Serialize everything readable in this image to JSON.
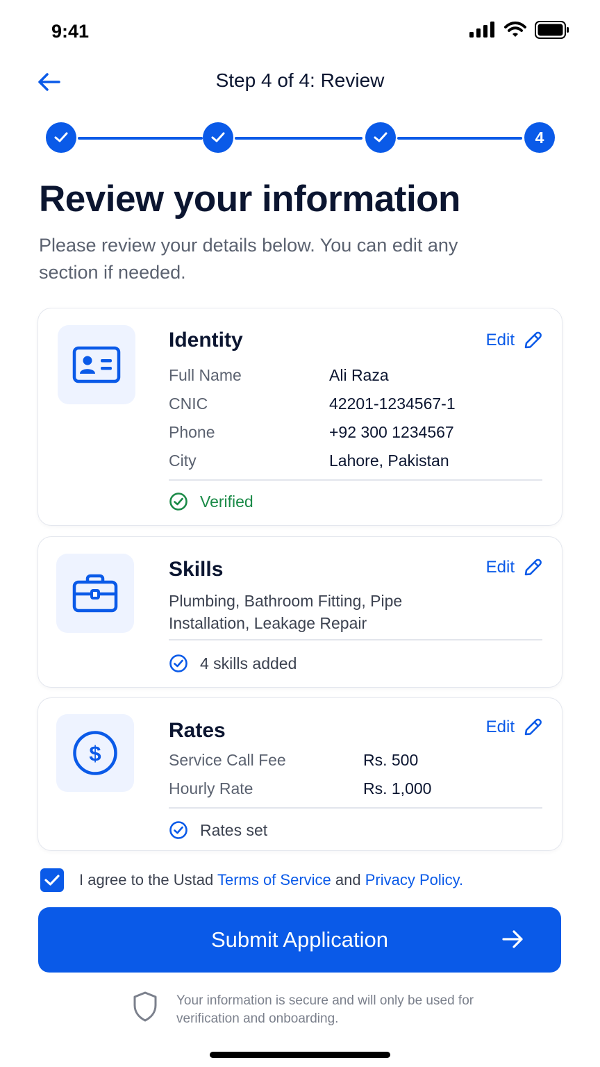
{
  "status_bar": {
    "time": "9:41"
  },
  "header": {
    "title": "Step 4 of 4: Review"
  },
  "stepper": {
    "current_step_label": "4"
  },
  "page": {
    "title": "Review your information",
    "subtitle": "Please review your details below. You can edit any section if needed."
  },
  "identity": {
    "title": "Identity",
    "edit_label": "Edit",
    "rows": [
      {
        "label": "Full Name",
        "value": "Ali Raza"
      },
      {
        "label": "CNIC",
        "value": "42201-1234567-1"
      },
      {
        "label": "Phone",
        "value": "+92 300 1234567"
      },
      {
        "label": "City",
        "value": "Lahore, Pakistan"
      }
    ],
    "status": "Verified"
  },
  "skills": {
    "title": "Skills",
    "edit_label": "Edit",
    "list": "Plumbing, Bathroom Fitting, Pipe Installation, Leakage Repair",
    "status": "4 skills added"
  },
  "rates": {
    "title": "Rates",
    "edit_label": "Edit",
    "rows": [
      {
        "label": "Service Call Fee",
        "value": "Rs. 500"
      },
      {
        "label": "Hourly Rate",
        "value": "Rs. 1,000"
      }
    ],
    "status": "Rates set"
  },
  "agreement": {
    "prefix": "I agree to the Ustad ",
    "terms_link": "Terms of Service",
    "middle": " and ",
    "privacy_link": "Privacy Policy",
    "suffix": ".",
    "checked": true
  },
  "submit": {
    "label": "Submit Application"
  },
  "security_note": "Your information is secure and will only be used for verification and onboarding.",
  "colors": {
    "primary": "#0a5ae8",
    "success": "#1a8a47",
    "text_dark": "#0b1530",
    "text_muted": "#5b6270",
    "icon_bg": "#eef3ff"
  }
}
